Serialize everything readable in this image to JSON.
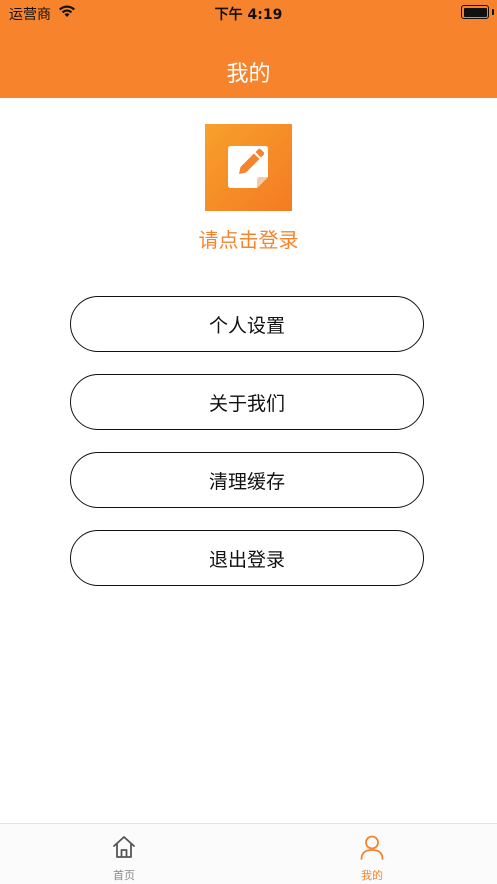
{
  "status_bar": {
    "carrier": "运营商",
    "time": "下午 4:19"
  },
  "nav": {
    "title": "我的"
  },
  "profile": {
    "login_prompt": "请点击登录",
    "icon": "edit-note-icon"
  },
  "menu": [
    {
      "label": "个人设置"
    },
    {
      "label": "关于我们"
    },
    {
      "label": "清理缓存"
    },
    {
      "label": "退出登录"
    }
  ],
  "tabs": [
    {
      "label": "首页",
      "icon": "home-icon",
      "active": false
    },
    {
      "label": "我的",
      "icon": "user-icon",
      "active": true
    }
  ],
  "colors": {
    "accent": "#F7842C",
    "tab_active": "#F7842C",
    "tab_inactive": "#8a8a8a"
  }
}
